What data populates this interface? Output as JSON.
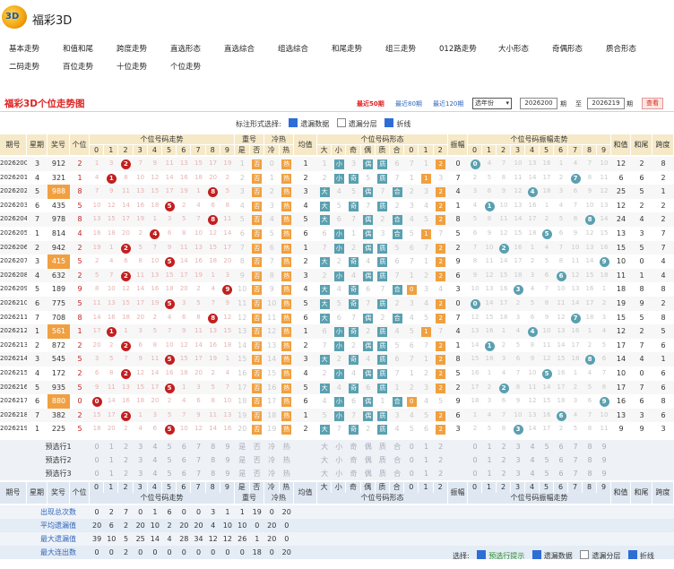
{
  "app": {
    "title": "福彩3D",
    "logo_text": "3D"
  },
  "nav": [
    "基本走势",
    "和值和尾",
    "跨度走势",
    "直选形态",
    "直选综合",
    "组选综合",
    "和尾走势",
    "组三走势",
    "012路走势",
    "大小形态",
    "奇偶形态",
    "质合形态",
    "二码走势",
    "百位走势",
    "十位走势",
    "个位走势"
  ],
  "page_title": "福彩3D个位走势图",
  "period_controls": {
    "recent_50": "最近50期",
    "recent_80": "最近80期",
    "recent_120": "最近120期",
    "select": "选年份",
    "from_value": "2026200",
    "from_unit": "期",
    "to_label": "至",
    "to_value": "2026219",
    "to_unit": "期",
    "query": "查看"
  },
  "options": {
    "label": "标注形式选择:",
    "omit": "遗漏数据",
    "omit_layer": "遗漏分层",
    "line": "折线"
  },
  "headers": {
    "period": "期号",
    "week": "星期",
    "award": "奖号",
    "unit": "个位",
    "trend_group": "个位号码走势",
    "digits": [
      "0",
      "1",
      "2",
      "3",
      "4",
      "5",
      "6",
      "7",
      "8",
      "9"
    ],
    "repeat_group": "重号",
    "repeat": [
      "是",
      "否"
    ],
    "hotcold_group": "冷热",
    "hotcold": [
      "冷",
      "热"
    ],
    "omit_avg": "均值",
    "form_group": "个位号码形态",
    "forms": [
      "大",
      "小",
      "奇",
      "偶",
      "质",
      "合",
      "0",
      "1",
      "2"
    ],
    "swing": "振幅",
    "swing_group": "个位号码振幅走势",
    "sum": "和值",
    "sumtail": "和尾",
    "span": "跨度"
  },
  "rows": [
    {
      "p": "2026200",
      "w": "3",
      "n": "912",
      "u": "2"
    },
    {
      "p": "2026201",
      "w": "4",
      "n": "321",
      "u": "1"
    },
    {
      "p": "2026202",
      "w": "5",
      "n": "988",
      "u": "8"
    },
    {
      "p": "2026203",
      "w": "6",
      "n": "435",
      "u": "5"
    },
    {
      "p": "2026204",
      "w": "7",
      "n": "978",
      "u": "8"
    },
    {
      "p": "2026205",
      "w": "1",
      "n": "814",
      "u": "4"
    },
    {
      "p": "2026206",
      "w": "2",
      "n": "942",
      "u": "2"
    },
    {
      "p": "2026207",
      "w": "3",
      "n": "415",
      "u": "5"
    },
    {
      "p": "2026208",
      "w": "4",
      "n": "632",
      "u": "2"
    },
    {
      "p": "2026209",
      "w": "5",
      "n": "189",
      "u": "9"
    },
    {
      "p": "2026210",
      "w": "6",
      "n": "775",
      "u": "5"
    },
    {
      "p": "2026211",
      "w": "7",
      "n": "708",
      "u": "8"
    },
    {
      "p": "2026212",
      "w": "1",
      "n": "561",
      "u": "1"
    },
    {
      "p": "2026213",
      "w": "2",
      "n": "872",
      "u": "2"
    },
    {
      "p": "2026214",
      "w": "3",
      "n": "545",
      "u": "5"
    },
    {
      "p": "2026215",
      "w": "4",
      "n": "172",
      "u": "2"
    },
    {
      "p": "2026216",
      "w": "5",
      "n": "935",
      "u": "5"
    },
    {
      "p": "2026217",
      "w": "6",
      "n": "880",
      "u": "0"
    },
    {
      "p": "2026218",
      "w": "7",
      "n": "382",
      "u": "2"
    },
    {
      "p": "2026219",
      "w": "1",
      "n": "225",
      "u": "5"
    }
  ],
  "predict": [
    "预选行1",
    "预选行2",
    "预选行3"
  ],
  "stats": [
    {
      "label": "出现总次数",
      "vals": [
        "0",
        "2",
        "7",
        "0",
        "1",
        "6",
        "0",
        "0",
        "3",
        "1",
        "1",
        "19",
        "0",
        "20"
      ]
    },
    {
      "label": "平均遗漏值",
      "vals": [
        "20",
        "6",
        "2",
        "20",
        "10",
        "2",
        "20",
        "20",
        "4",
        "10",
        "10",
        "0",
        "20",
        "0"
      ]
    },
    {
      "label": "最大遗漏值",
      "vals": [
        "39",
        "10",
        "5",
        "25",
        "14",
        "4",
        "28",
        "34",
        "12",
        "12",
        "26",
        "1",
        "20",
        "0"
      ]
    },
    {
      "label": "最大连出数",
      "vals": [
        "0",
        "0",
        "2",
        "0",
        "0",
        "0",
        "0",
        "0",
        "0",
        "0",
        "0",
        "18",
        "0",
        "20"
      ]
    }
  ],
  "footer": {
    "label": "选择:",
    "predict": "预选行提示",
    "omit": "遗漏数据",
    "omit_layer": "遗漏分层",
    "line": "折线"
  },
  "colors": {
    "accent": "#d22222",
    "ball": "#c21f1f",
    "square_orange": "#f0a040",
    "square_teal": "#5aa0b0",
    "header": "#f5e9c8"
  }
}
